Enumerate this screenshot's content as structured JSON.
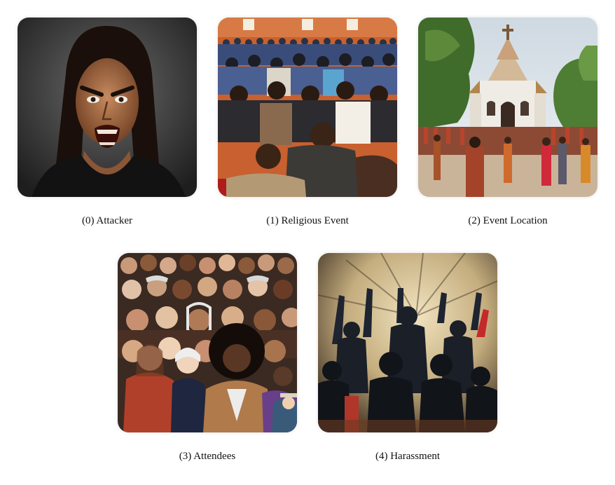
{
  "panels": [
    {
      "caption": "(0) Attacker",
      "image_icon": "angry-woman-portrait"
    },
    {
      "caption": "(1) Religious Event",
      "image_icon": "crowd-congregation"
    },
    {
      "caption": "(2) Event Location",
      "image_icon": "church-with-crowd"
    },
    {
      "caption": "(3) Attendees",
      "image_icon": "diverse-crowd"
    },
    {
      "caption": "(4) Harassment",
      "image_icon": "raised-fists-crowd"
    }
  ],
  "colors": {
    "background": "#ffffff",
    "caption_text": "#111111"
  }
}
